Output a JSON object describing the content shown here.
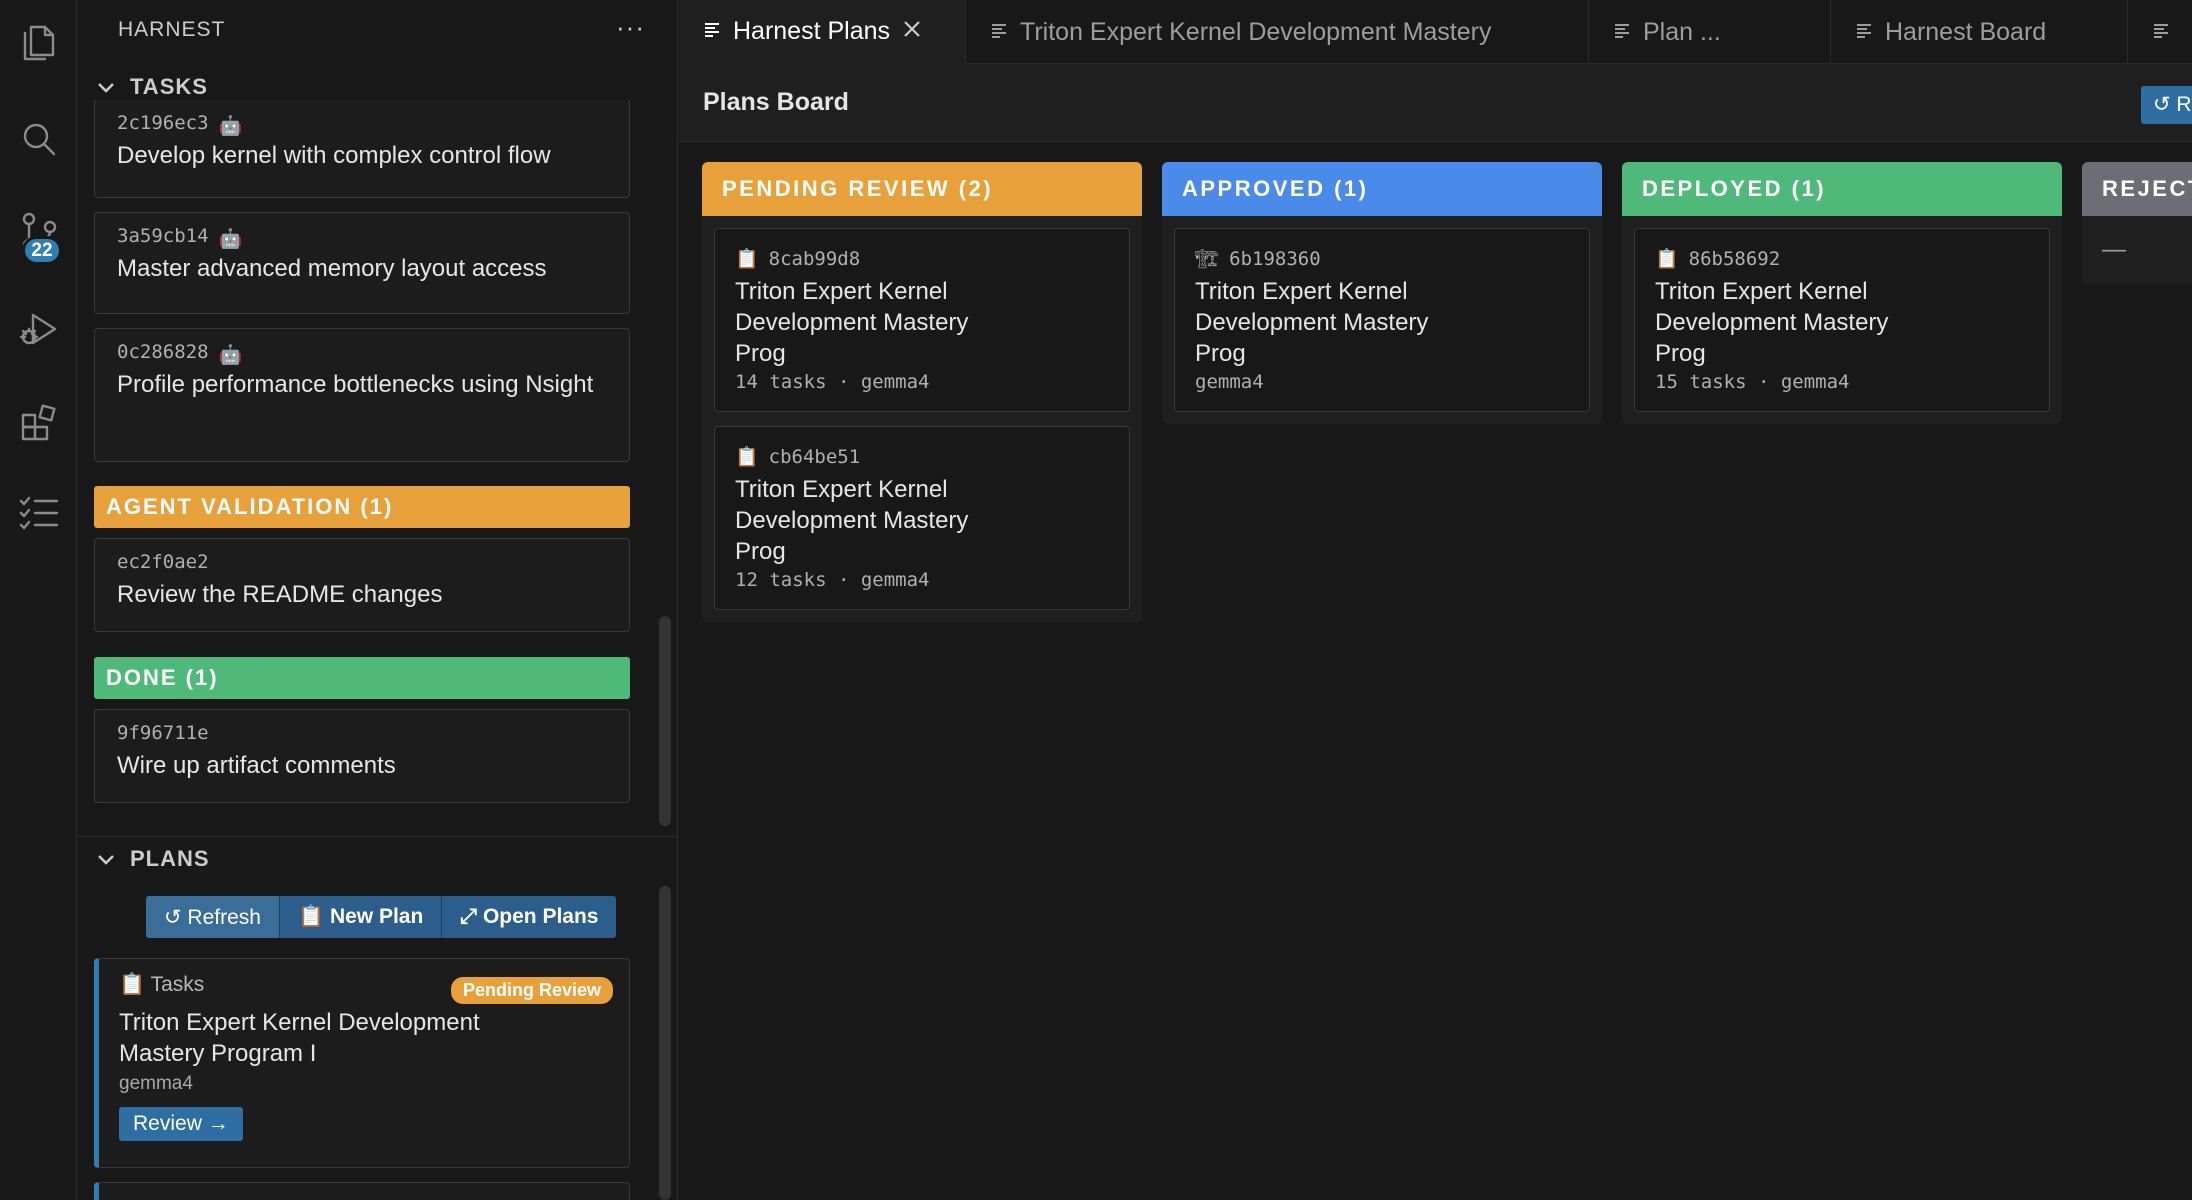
{
  "activity_bar": {
    "icons": [
      "files-icon",
      "search-icon",
      "source-control-icon",
      "run-debug-icon",
      "extensions-icon",
      "checklist-icon"
    ],
    "source_control_badge": "22"
  },
  "sidebar": {
    "title": "HARNEST",
    "more": "···",
    "tasks_section": "TASKS",
    "tasks": [
      {
        "id": "2c196ec3",
        "title": "Develop kernel with complex control flow",
        "agent": true
      },
      {
        "id": "3a59cb14",
        "title": "Master advanced memory layout access",
        "agent": true
      },
      {
        "id": "0c286828",
        "title": "Profile performance bottlenecks using Nsight",
        "agent": true
      }
    ],
    "groups": [
      {
        "label": "AGENT VALIDATION (1)",
        "color": "#e8a03a",
        "items": [
          {
            "id": "ec2f0ae2",
            "title": "Review the README changes"
          }
        ]
      },
      {
        "label": "DONE (1)",
        "color": "#4fb97a",
        "items": [
          {
            "id": "9f96711e",
            "title": "Wire up artifact comments"
          }
        ]
      }
    ],
    "plans_section": "PLANS",
    "buttons": {
      "refresh": "↺ Refresh",
      "new_plan": "📋 New Plan",
      "open_plans": "⤢ Open Plans"
    },
    "plan_card": {
      "type": "📋 Tasks",
      "status": "Pending Review",
      "title": "Triton Expert Kernel Development Mastery Program I",
      "model": "gemma4",
      "review": "Review →"
    }
  },
  "editor": {
    "tabs": [
      {
        "label": "Harnest Plans",
        "active": true
      },
      {
        "label": "Triton Expert Kernel Development Mastery",
        "active": false
      },
      {
        "label": "Plan ...",
        "active": false
      },
      {
        "label": "Harnest Board",
        "active": false
      }
    ],
    "board_title": "Plans Board",
    "board_refresh": "↺ R",
    "columns": [
      {
        "label": "PENDING REVIEW (2)",
        "color": "#e8a03a",
        "cards": [
          {
            "icon": "📋",
            "id": "8cab99d8",
            "title": "Triton Expert Kernel Development Mastery Prog",
            "meta": "14 tasks · gemma4"
          },
          {
            "icon": "📋",
            "id": "cb64be51",
            "title": "Triton Expert Kernel Development Mastery Prog",
            "meta": "12 tasks · gemma4"
          }
        ]
      },
      {
        "label": "APPROVED (1)",
        "color": "#4a8ae8",
        "cards": [
          {
            "icon": "🏗",
            "id": "6b198360",
            "title": "Triton Expert Kernel Development Mastery Prog",
            "meta": "gemma4"
          }
        ]
      },
      {
        "label": "DEPLOYED (1)",
        "color": "#4fb97a",
        "cards": [
          {
            "icon": "📋",
            "id": "86b58692",
            "title": "Triton Expert Kernel Development Mastery Prog",
            "meta": "15 tasks · gemma4"
          }
        ]
      },
      {
        "label": "REJECT",
        "color": "#6b6e76",
        "empty": "—"
      }
    ]
  }
}
